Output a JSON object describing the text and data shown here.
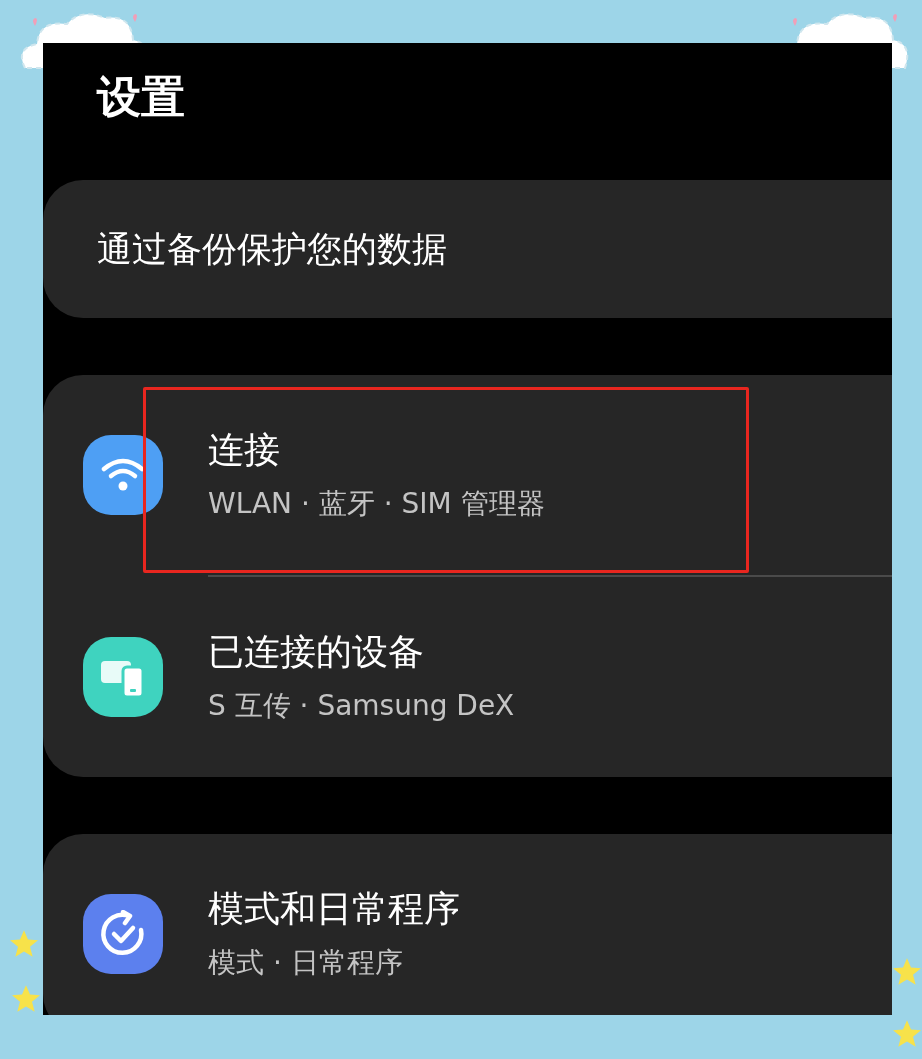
{
  "title": "设置",
  "sections": [
    {
      "items": [
        {
          "kind": "text",
          "title": "通过备份保护您的数据"
        }
      ]
    },
    {
      "items": [
        {
          "kind": "wifi",
          "color": "#4e9ff4",
          "title": "连接",
          "subtitle": "WLAN · 蓝牙 · SIM 管理器",
          "highlighted": true
        },
        {
          "kind": "devices",
          "color": "#3fd3bf",
          "title": "已连接的设备",
          "subtitle": "S 互传 · Samsung DeX",
          "highlighted": false
        }
      ]
    },
    {
      "items": [
        {
          "kind": "routine",
          "color": "#5c80ee",
          "title": "模式和日常程序",
          "subtitle": "模式 · 日常程序",
          "highlighted": false
        }
      ]
    }
  ]
}
